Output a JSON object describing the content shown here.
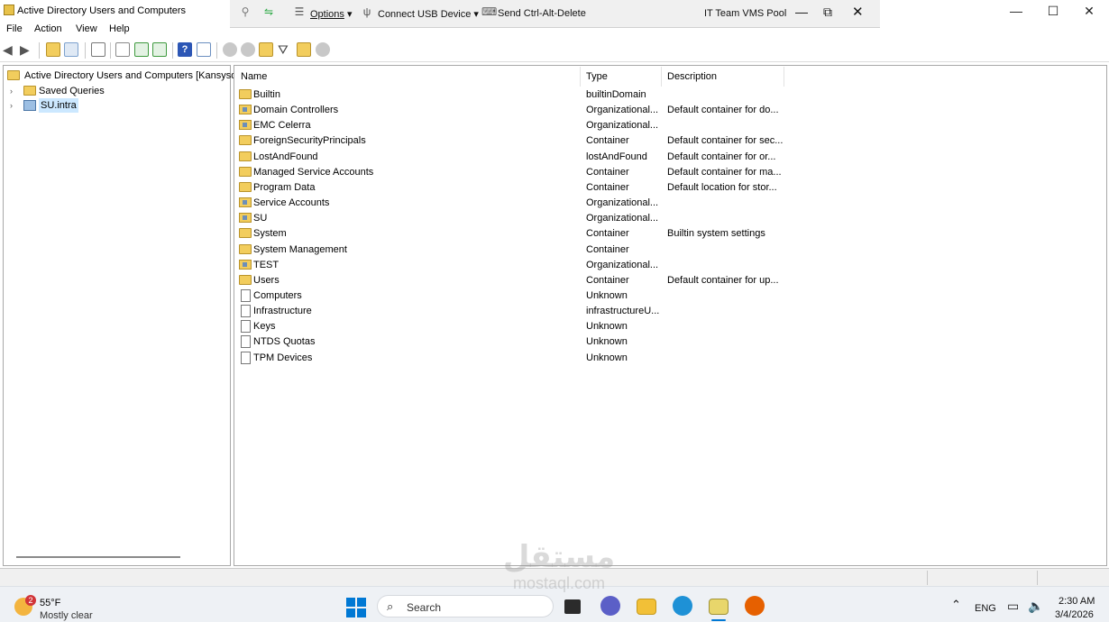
{
  "window": {
    "title": "Active Directory Users and Computers",
    "controls": {
      "minimize": "—",
      "maximize": "☐",
      "close": "✕"
    }
  },
  "vm_toolbar": {
    "options_label": "Options",
    "connect_usb_label": "Connect USB Device",
    "send_cad_label": "Send Ctrl-Alt-Delete",
    "pool_name": "IT Team VMS Pool",
    "controls": {
      "minimize": "—",
      "restore": "⧉",
      "close": "✕"
    }
  },
  "menu": {
    "file": "File",
    "action": "Action",
    "view": "View",
    "help": "Help"
  },
  "tree": {
    "root": "Active Directory Users and Computers [Kansysdc",
    "items": [
      {
        "label": "Saved Queries"
      },
      {
        "label": "SU.intra"
      }
    ]
  },
  "list": {
    "columns": {
      "name": "Name",
      "type": "Type",
      "description": "Description"
    },
    "rows": [
      {
        "name": "Builtin",
        "type": "builtinDomain",
        "description": "",
        "icon": "folder-icon"
      },
      {
        "name": "Domain Controllers",
        "type": "Organizational...",
        "description": "Default container for do...",
        "icon": "ou-icon"
      },
      {
        "name": "EMC Celerra",
        "type": "Organizational...",
        "description": "",
        "icon": "ou-icon"
      },
      {
        "name": "ForeignSecurityPrincipals",
        "type": "Container",
        "description": "Default container for sec...",
        "icon": "folder-icon"
      },
      {
        "name": "LostAndFound",
        "type": "lostAndFound",
        "description": "Default container for or...",
        "icon": "folder-icon"
      },
      {
        "name": "Managed Service Accounts",
        "type": "Container",
        "description": "Default container for ma...",
        "icon": "folder-icon"
      },
      {
        "name": "Program Data",
        "type": "Container",
        "description": "Default location for stor...",
        "icon": "folder-icon"
      },
      {
        "name": "Service Accounts",
        "type": "Organizational...",
        "description": "",
        "icon": "ou-icon"
      },
      {
        "name": "SU",
        "type": "Organizational...",
        "description": "",
        "icon": "ou-icon"
      },
      {
        "name": "System",
        "type": "Container",
        "description": "Builtin system settings",
        "icon": "folder-icon"
      },
      {
        "name": "System Management",
        "type": "Container",
        "description": "",
        "icon": "folder-icon"
      },
      {
        "name": "TEST",
        "type": "Organizational...",
        "description": "",
        "icon": "ou-icon"
      },
      {
        "name": "Users",
        "type": "Container",
        "description": "Default container for up...",
        "icon": "folder-icon"
      },
      {
        "name": "Computers",
        "type": "Unknown",
        "description": "",
        "icon": "document-icon"
      },
      {
        "name": "Infrastructure",
        "type": "infrastructureU...",
        "description": "",
        "icon": "document-icon"
      },
      {
        "name": "Keys",
        "type": "Unknown",
        "description": "",
        "icon": "document-icon"
      },
      {
        "name": "NTDS Quotas",
        "type": "Unknown",
        "description": "",
        "icon": "document-icon"
      },
      {
        "name": "TPM Devices",
        "type": "Unknown",
        "description": "",
        "icon": "document-icon"
      }
    ]
  },
  "taskbar": {
    "weather_temp": "55°F",
    "weather_desc": "Mostly clear",
    "weather_badge": "2",
    "search_placeholder": "Search",
    "language": "ENG",
    "time": "2:30 AM",
    "date": "3/4/2026"
  },
  "watermark": {
    "arabic": "مستقل",
    "latin": "mostaql.com"
  },
  "colors": {
    "selection": "#cce8ff",
    "folder": "#f2cd5d",
    "windows_blue": "#0078d4"
  }
}
